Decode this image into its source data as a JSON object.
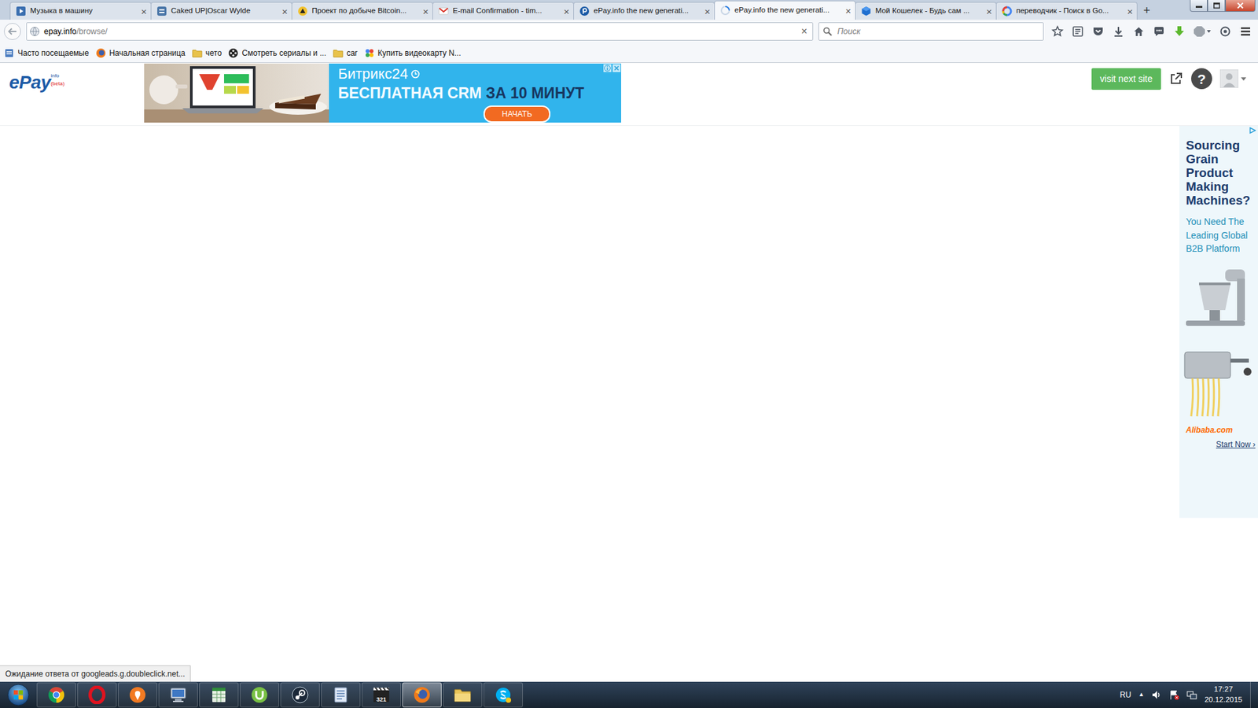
{
  "tabs": [
    {
      "label": "Музыка в машину",
      "kind": "video",
      "selected": false,
      "close": "×"
    },
    {
      "label": "Caked UP|Oscar Wylde",
      "kind": "vk",
      "selected": false,
      "close": "×"
    },
    {
      "label": "Проект по добыче Bitcoin...",
      "kind": "miner",
      "selected": false,
      "close": "×"
    },
    {
      "label": "E-mail Confirmation - tim...",
      "kind": "gmail",
      "selected": false,
      "close": "×"
    },
    {
      "label": "ePay.info the new generati...",
      "kind": "epay",
      "selected": false,
      "close": "×"
    },
    {
      "label": "ePay.info the new generati...",
      "kind": "loading",
      "selected": true,
      "close": "×"
    },
    {
      "label": "Мой Кошелек - Будь сам ...",
      "kind": "wallet",
      "selected": false,
      "close": "×"
    },
    {
      "label": "переводчик - Поиск в Go...",
      "kind": "google",
      "selected": false,
      "close": "×"
    }
  ],
  "new_tab": "+",
  "toolbar": {
    "url_host": "epay.info",
    "url_path": "/browse/",
    "stop": "×",
    "search_placeholder": "Поиск"
  },
  "bookmarks": [
    {
      "label": "Часто посещаемые",
      "kind": "smart"
    },
    {
      "label": "Начальная страница",
      "kind": "firefox"
    },
    {
      "label": "чето",
      "kind": "folder"
    },
    {
      "label": "Смотреть сериалы и ...",
      "kind": "film"
    },
    {
      "label": "car",
      "kind": "folder"
    },
    {
      "label": "Купить видеокарту N...",
      "kind": "shop"
    }
  ],
  "page": {
    "logo": "ePay",
    "logo_sup": "info",
    "logo_tag": "(beta)",
    "banner": {
      "brand": "Битрикс24",
      "headline_a": "БЕСПЛАТНАЯ CRM ",
      "headline_b": "ЗА 10 МИНУТ",
      "cta": "НАЧАТЬ"
    },
    "visit_button": "visit next site",
    "help": "?",
    "side_ad": {
      "headline": "Sourcing Grain Product Making Machines?",
      "body": "You Need The Leading Global B2B Platform",
      "brand": "Alibaba.com",
      "cta": "Start Now ›"
    }
  },
  "status_bar": "Ожидание ответа от googleads.g.doubleclick.net...",
  "taskbar": {
    "apps": [
      {
        "kind": "chrome",
        "selected": false
      },
      {
        "kind": "opera",
        "selected": false
      },
      {
        "kind": "maps",
        "selected": false
      },
      {
        "kind": "monitor",
        "selected": false
      },
      {
        "kind": "sheet",
        "selected": false
      },
      {
        "kind": "utorrent",
        "selected": false
      },
      {
        "kind": "steam",
        "selected": false
      },
      {
        "kind": "notes",
        "selected": false
      },
      {
        "kind": "mpc",
        "selected": false,
        "label": "321"
      },
      {
        "kind": "firefox",
        "selected": true
      },
      {
        "kind": "folder",
        "selected": false
      },
      {
        "kind": "skype",
        "selected": false
      }
    ],
    "language": "RU",
    "tray_toggle": "▲",
    "time": "17:27",
    "date": "20.12.2015"
  }
}
